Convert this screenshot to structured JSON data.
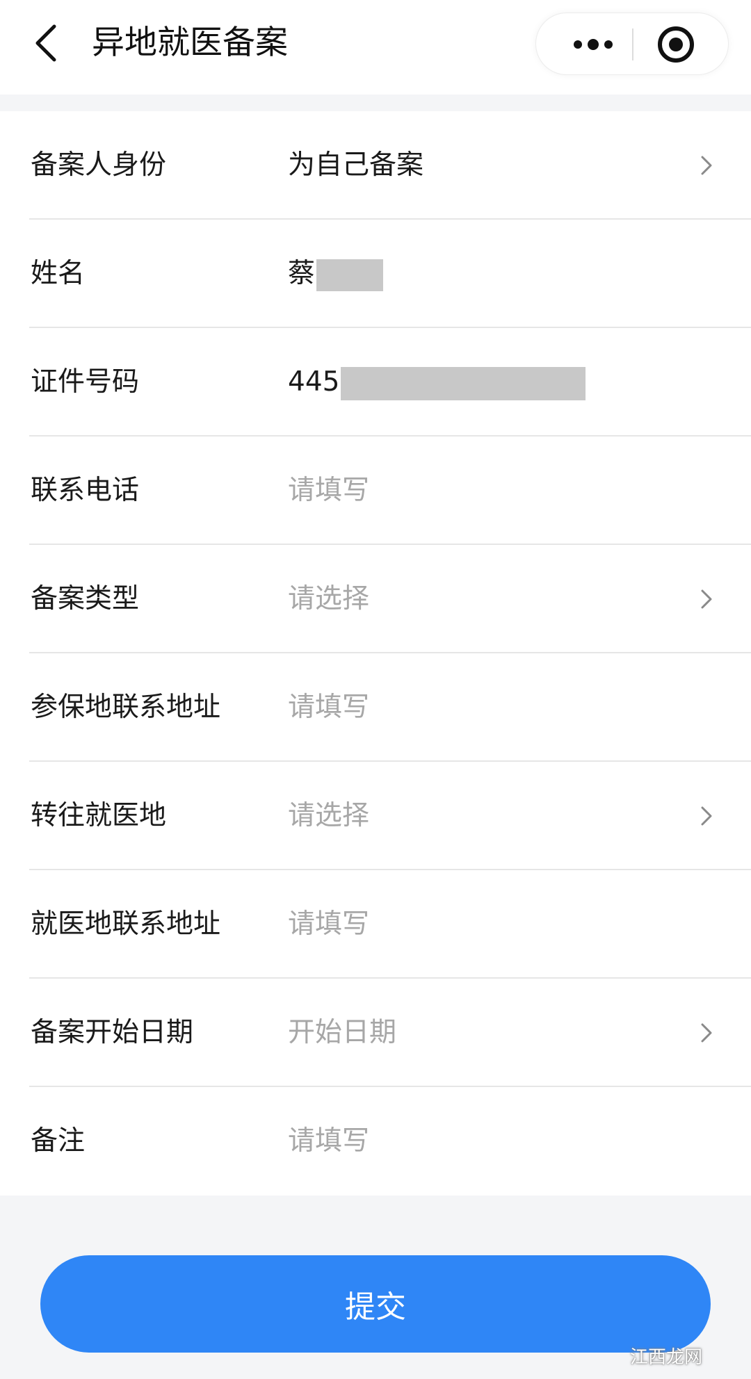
{
  "header": {
    "title": "异地就医备案"
  },
  "form": {
    "rows": [
      {
        "label": "备案人身份",
        "value": "为自己备案",
        "placeholder": false,
        "has_chevron": true
      },
      {
        "label": "姓名",
        "value": "蔡",
        "placeholder": false,
        "has_chevron": false
      },
      {
        "label": "证件号码",
        "value": "445",
        "placeholder": false,
        "has_chevron": false
      },
      {
        "label": "联系电话",
        "value": "请填写",
        "placeholder": true,
        "has_chevron": false
      },
      {
        "label": "备案类型",
        "value": "请选择",
        "placeholder": true,
        "has_chevron": true
      },
      {
        "label": "参保地联系地址",
        "value": "请填写",
        "placeholder": true,
        "has_chevron": false
      },
      {
        "label": "转往就医地",
        "value": "请选择",
        "placeholder": true,
        "has_chevron": true
      },
      {
        "label": "就医地联系地址",
        "value": "请填写",
        "placeholder": true,
        "has_chevron": false
      },
      {
        "label": "备案开始日期",
        "value": "开始日期",
        "placeholder": true,
        "has_chevron": true
      },
      {
        "label": "备注",
        "value": "请填写",
        "placeholder": true,
        "has_chevron": false
      }
    ]
  },
  "submit": {
    "label": "提交"
  },
  "watermark": {
    "text": "江西龙网"
  },
  "colors": {
    "accent": "#2f86f6",
    "placeholder": "#a7a7a7",
    "text": "#1a1a1a",
    "background": "#f4f5f7"
  },
  "icons": {
    "back": "chevron-left-icon",
    "more": "more-dots-icon",
    "close": "target-circle-icon",
    "row_arrow": "chevron-right-icon"
  }
}
